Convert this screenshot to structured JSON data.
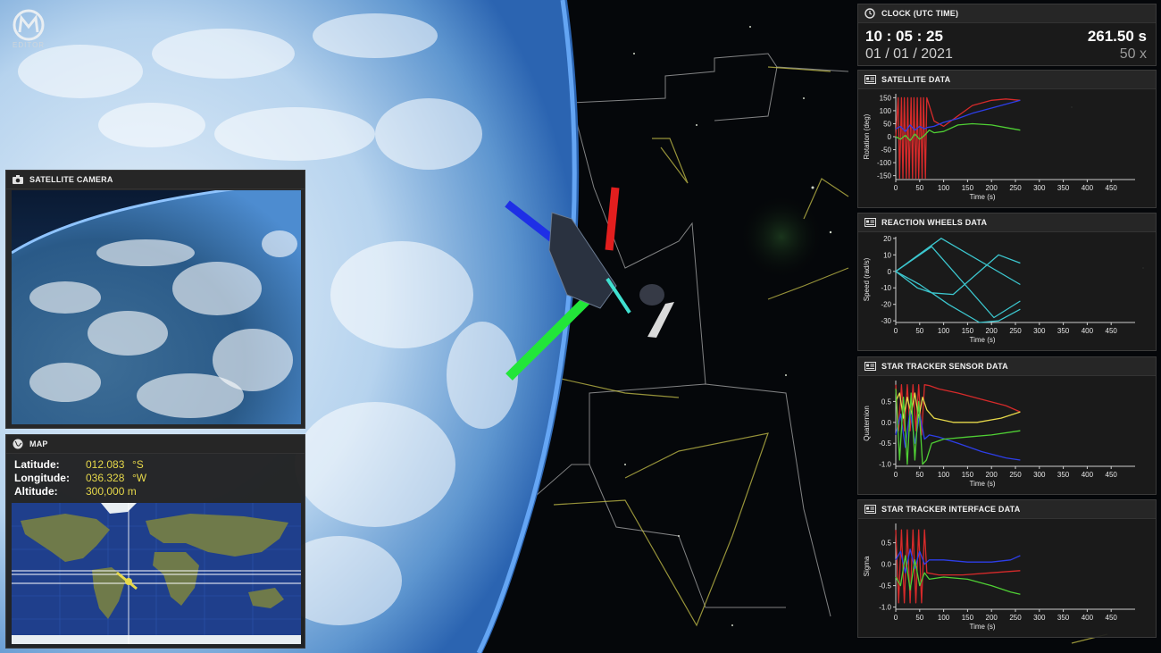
{
  "logo": {
    "text": "EDITOR"
  },
  "camera": {
    "title": "SATELLITE CAMERA"
  },
  "map": {
    "title": "MAP",
    "latitude_label": "Latitude:",
    "latitude_value": "012.083",
    "latitude_unit": "°S",
    "longitude_label": "Longitude:",
    "longitude_value": "036.328",
    "longitude_unit": "°W",
    "altitude_label": "Altitude:",
    "altitude_value": "300,000 m"
  },
  "clock": {
    "title": "CLOCK (UTC TIME)",
    "time": "10 : 05 : 25",
    "date": "01 / 01 / 2021",
    "elapsed": "261.50 s",
    "speed": "50 x"
  },
  "charts": {
    "satellite": {
      "title": "SATELLITE DATA"
    },
    "reaction_wheels": {
      "title": "REACTION WHEELS DATA"
    },
    "star_tracker_sensor": {
      "title": "STAR TRACKER SENSOR DATA"
    },
    "star_tracker_interface": {
      "title": "STAR TRACKER INTERFACE DATA"
    }
  },
  "colors": {
    "red": "#d62a2a",
    "blue": "#2d3ee8",
    "green": "#4fcf34",
    "yellow": "#e6d84a",
    "cyan": "#3cc7cf"
  },
  "chart_data": [
    {
      "id": "satellite",
      "type": "line",
      "xlabel": "Time (s)",
      "ylabel": "Rotation (deg)",
      "xlim": [
        0,
        500
      ],
      "ylim": [
        -165,
        165
      ],
      "xticks": [
        0,
        50,
        100,
        150,
        200,
        250,
        300,
        350,
        400,
        450
      ],
      "yticks": [
        150,
        100,
        50,
        0,
        -50,
        -100,
        -150
      ],
      "series": [
        {
          "color": "red",
          "x": [
            0,
            5,
            8,
            12,
            15,
            18,
            22,
            25,
            28,
            32,
            35,
            38,
            42,
            45,
            48,
            52,
            55,
            58,
            62,
            65,
            70,
            80,
            100,
            130,
            160,
            200,
            230,
            260
          ],
          "y": [
            0,
            150,
            -160,
            150,
            -160,
            150,
            -160,
            150,
            -160,
            150,
            -160,
            150,
            -160,
            150,
            -160,
            150,
            -160,
            150,
            -160,
            150,
            120,
            60,
            40,
            80,
            120,
            140,
            145,
            140
          ]
        },
        {
          "color": "blue",
          "x": [
            0,
            10,
            20,
            30,
            40,
            50,
            60,
            65,
            80,
            100,
            130,
            160,
            200,
            230,
            260
          ],
          "y": [
            30,
            40,
            20,
            45,
            25,
            40,
            30,
            35,
            40,
            55,
            70,
            90,
            110,
            125,
            140
          ]
        },
        {
          "color": "green",
          "x": [
            0,
            10,
            20,
            30,
            40,
            50,
            60,
            70,
            80,
            100,
            130,
            160,
            200,
            230,
            260
          ],
          "y": [
            0,
            -10,
            5,
            -15,
            10,
            -10,
            5,
            25,
            15,
            20,
            45,
            50,
            45,
            35,
            25
          ]
        }
      ]
    },
    {
      "id": "reaction_wheels",
      "type": "line",
      "xlabel": "Time (s)",
      "ylabel": "Speed (rad/s)",
      "xlim": [
        0,
        500
      ],
      "ylim": [
        -31,
        21
      ],
      "xticks": [
        0,
        50,
        100,
        150,
        200,
        250,
        300,
        350,
        400,
        450
      ],
      "yticks": [
        20,
        10,
        0,
        -10,
        -20,
        -30
      ],
      "series": [
        {
          "color": "cyan",
          "x": [
            0,
            95,
            260
          ],
          "y": [
            0,
            20,
            -8
          ]
        },
        {
          "color": "cyan",
          "x": [
            0,
            75,
            205,
            260
          ],
          "y": [
            0,
            15,
            -28,
            -18
          ]
        },
        {
          "color": "cyan",
          "x": [
            0,
            45,
            75,
            120,
            215,
            260
          ],
          "y": [
            0,
            -10,
            -13,
            -14,
            10,
            5
          ]
        },
        {
          "color": "cyan",
          "x": [
            0,
            50,
            110,
            175,
            215,
            260
          ],
          "y": [
            0,
            -8,
            -20,
            -31,
            -30,
            -23
          ]
        }
      ]
    },
    {
      "id": "star_tracker_sensor",
      "type": "line",
      "xlabel": "Time (s)",
      "ylabel": "Quaternion",
      "xlim": [
        0,
        500
      ],
      "ylim": [
        -1.05,
        1.0
      ],
      "xticks": [
        0,
        50,
        100,
        150,
        200,
        250,
        300,
        350,
        400,
        450
      ],
      "yticks": [
        0.5,
        0.0,
        -0.5,
        -1.0
      ],
      "series": [
        {
          "color": "red",
          "x": [
            0,
            6,
            12,
            18,
            24,
            30,
            36,
            42,
            48,
            54,
            60,
            70,
            90,
            130,
            180,
            230,
            260
          ],
          "y": [
            0.9,
            -0.2,
            0.9,
            -0.2,
            0.9,
            -0.2,
            0.9,
            -0.2,
            0.9,
            -0.3,
            0.9,
            0.88,
            0.8,
            0.7,
            0.55,
            0.4,
            0.25
          ]
        },
        {
          "color": "yellow",
          "x": [
            0,
            8,
            16,
            24,
            32,
            40,
            48,
            56,
            65,
            80,
            120,
            170,
            220,
            260
          ],
          "y": [
            0.5,
            0.7,
            0.1,
            0.6,
            0.2,
            0.7,
            0.1,
            0.6,
            0.3,
            0.1,
            0.0,
            0.0,
            0.1,
            0.25
          ]
        },
        {
          "color": "blue",
          "x": [
            0,
            10,
            20,
            30,
            40,
            50,
            60,
            70,
            90,
            130,
            180,
            230,
            260
          ],
          "y": [
            -0.3,
            0.2,
            -0.6,
            0.3,
            -0.5,
            0.2,
            -0.4,
            -0.3,
            -0.35,
            -0.5,
            -0.7,
            -0.85,
            -0.9
          ]
        },
        {
          "color": "green",
          "x": [
            0,
            8,
            16,
            24,
            32,
            40,
            48,
            56,
            64,
            75,
            100,
            150,
            200,
            260
          ],
          "y": [
            0.8,
            -0.9,
            0.6,
            -1.0,
            0.7,
            -0.9,
            0.5,
            -1.0,
            -0.9,
            -0.5,
            -0.4,
            -0.35,
            -0.3,
            -0.2
          ]
        }
      ]
    },
    {
      "id": "star_tracker_interface",
      "type": "line",
      "xlabel": "Time (s)",
      "ylabel": "Sigma",
      "xlim": [
        0,
        500
      ],
      "ylim": [
        -1.05,
        0.95
      ],
      "xticks": [
        0,
        50,
        100,
        150,
        200,
        250,
        300,
        350,
        400,
        450
      ],
      "yticks": [
        0.5,
        0.0,
        -0.5,
        -1.0
      ],
      "series": [
        {
          "color": "red",
          "x": [
            0,
            6,
            12,
            18,
            24,
            30,
            36,
            42,
            48,
            54,
            60,
            65,
            90,
            140,
            200,
            260
          ],
          "y": [
            0.8,
            -0.9,
            0.8,
            -0.9,
            0.8,
            -0.9,
            0.8,
            -0.9,
            0.8,
            -0.9,
            0.8,
            -0.2,
            -0.25,
            -0.25,
            -0.2,
            -0.15
          ]
        },
        {
          "color": "blue",
          "x": [
            0,
            10,
            20,
            30,
            40,
            50,
            60,
            70,
            100,
            150,
            200,
            240,
            260
          ],
          "y": [
            0.1,
            0.3,
            -0.2,
            0.35,
            -0.1,
            0.3,
            0.0,
            0.1,
            0.1,
            0.05,
            0.05,
            0.1,
            0.2
          ]
        },
        {
          "color": "green",
          "x": [
            0,
            10,
            20,
            30,
            40,
            50,
            60,
            70,
            100,
            150,
            200,
            240,
            260
          ],
          "y": [
            -0.3,
            -0.5,
            0.2,
            -0.6,
            0.1,
            -0.5,
            -0.2,
            -0.35,
            -0.3,
            -0.35,
            -0.5,
            -0.65,
            -0.7
          ]
        }
      ]
    }
  ]
}
